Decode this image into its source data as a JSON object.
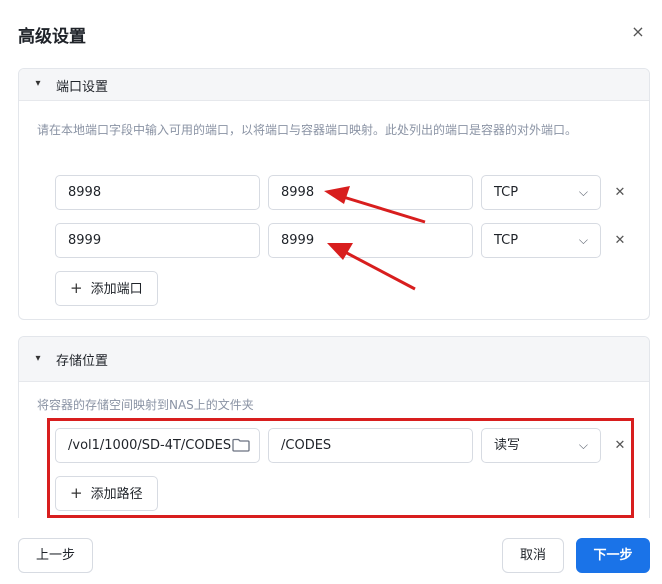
{
  "dialog": {
    "title": "高级设置",
    "close_symbol": "×"
  },
  "ports": {
    "section_label": "端口设置",
    "description": "请在本地端口字段中输入可用的端口，以将端口与容器端口映射。此处列出的端口是容器的对外端口。",
    "rows": [
      {
        "local": "8998",
        "container": "8998",
        "protocol": "TCP"
      },
      {
        "local": "8999",
        "container": "8999",
        "protocol": "TCP"
      }
    ],
    "add_label": "添加端口"
  },
  "storage": {
    "section_label": "存储位置",
    "description": "将容器的存储空间映射到NAS上的文件夹",
    "rows": [
      {
        "host_path": "/vol1/1000/SD-4T/CODES",
        "container_path": "/CODES",
        "mode": "读写"
      }
    ],
    "add_label": "添加路径"
  },
  "footer": {
    "prev_label": "上一步",
    "cancel_label": "取消",
    "next_label": "下一步"
  },
  "colors": {
    "primary": "#1a73e8",
    "annotation_red": "#d81e1e"
  }
}
